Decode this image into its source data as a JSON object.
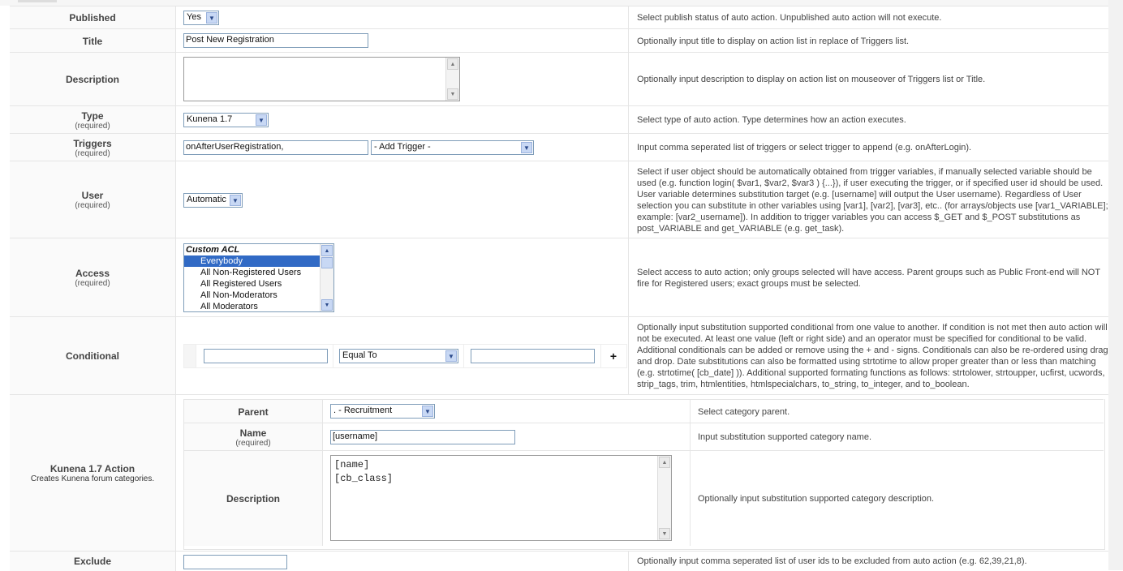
{
  "rows": {
    "published": {
      "label": "Published",
      "value": "Yes",
      "help": "Select publish status of auto action. Unpublished auto action will not execute."
    },
    "title": {
      "label": "Title",
      "value": "Post New Registration",
      "help": "Optionally input title to display on action list in replace of Triggers list."
    },
    "description": {
      "label": "Description",
      "value": "",
      "help": "Optionally input description to display on action list on mouseover of Triggers list or Title."
    },
    "type": {
      "label": "Type",
      "required": "(required)",
      "value": "Kunena 1.7",
      "help": "Select type of auto action. Type determines how an action executes."
    },
    "triggers": {
      "label": "Triggers",
      "required": "(required)",
      "value": "onAfterUserRegistration,",
      "select": "- Add Trigger -",
      "help": "Input comma seperated list of triggers or select trigger to append (e.g. onAfterLogin)."
    },
    "user": {
      "label": "User",
      "required": "(required)",
      "value": "Automatic",
      "help": "Select if user object should be automatically obtained from trigger variables, if manually selected variable should be used (e.g. function login( $var1, $var2, $var3 ) {...}), if user executing the trigger, or if specified user id should be used. User variable determines substitution target (e.g. [username] will output the User username). Regardless of User selection you can substitute in other variables using [var1], [var2], [var3], etc.. (for arrays/objects use [var1_VARIABLE]; example: [var2_username]). In addition to trigger variables you can access $_GET and $_POST substitutions as post_VARIABLE and get_VARIABLE (e.g. get_task)."
    },
    "access": {
      "label": "Access",
      "required": "(required)",
      "group": "Custom ACL",
      "options": [
        "Everybody",
        "All Non-Registered Users",
        "All Registered Users",
        "All Non-Moderators",
        "All Moderators"
      ],
      "selected": "Everybody",
      "help": "Select access to auto action; only groups selected will have access. Parent groups such as Public Front-end will NOT fire for Registered users; exact groups must be selected."
    },
    "conditional": {
      "label": "Conditional",
      "left": "",
      "operator": "Equal To",
      "right": "",
      "add": "+",
      "help": "Optionally input substitution supported conditional from one value to another. If condition is not met then auto action will not be executed. At least one value (left or right side) and an operator must be specified for conditional to be valid. Additional conditionals can be added or remove using the + and - signs. Conditionals can also be re-ordered using drag and drop. Date substitutions can also be formatted using strtotime to allow proper greater than or less than matching (e.g. strtotime( [cb_date] )). Additional supported formating functions as follows: strtolower, strtoupper, ucfirst, ucwords, strip_tags, trim, htmlentities, htmlspecialchars, to_string, to_integer, and to_boolean."
    },
    "action": {
      "label": "Kunena 1.7 Action",
      "sub": "Creates Kunena forum categories.",
      "parent": {
        "label": "Parent",
        "value": ".  - Recruitment",
        "help": "Select category parent."
      },
      "name": {
        "label": "Name",
        "required": "(required)",
        "value": "[username]",
        "help": "Input substitution supported category name."
      },
      "description": {
        "label": "Description",
        "value": "[name]\n[cb_class]",
        "help": "Optionally input substitution supported category description."
      }
    },
    "exclude": {
      "label": "Exclude",
      "value": "",
      "help": "Optionally input comma seperated list of user ids to be excluded from auto action (e.g. 62,39,21,8)."
    }
  }
}
